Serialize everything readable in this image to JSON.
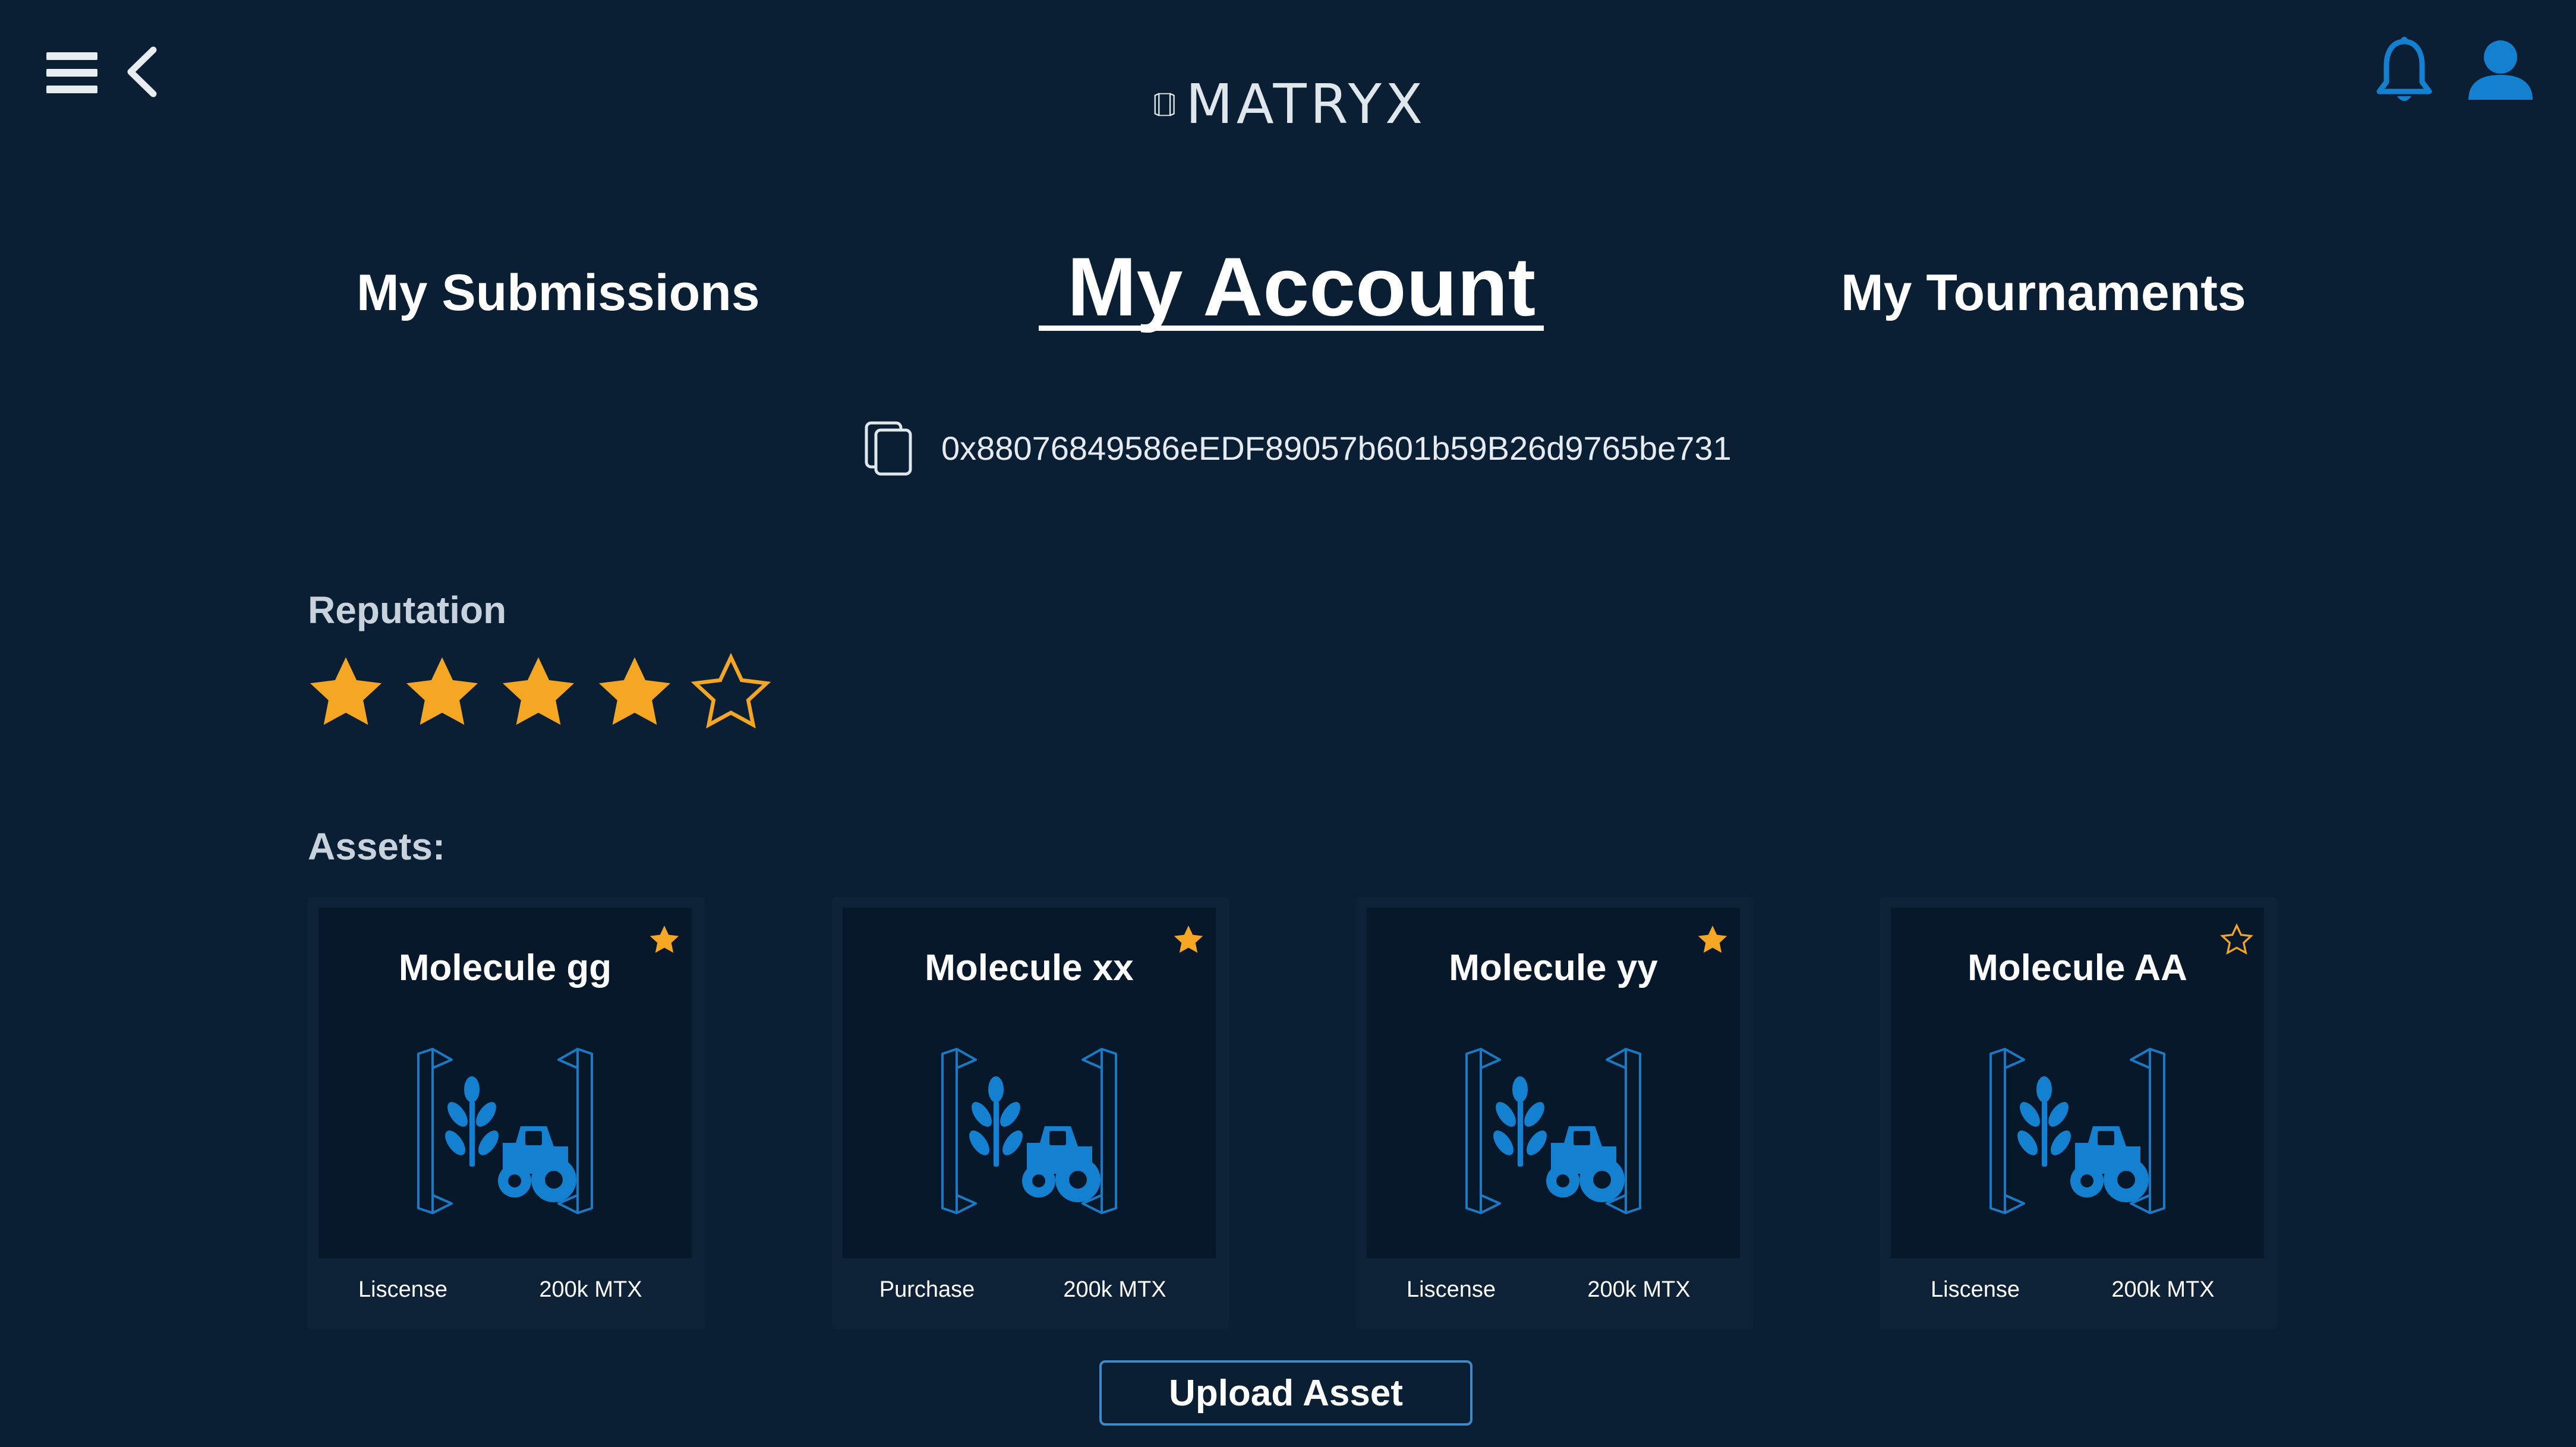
{
  "app": {
    "logo_text": "MATRYX"
  },
  "header": {
    "menu_icon": "hamburger-menu-icon",
    "back_icon": "chevron-left-icon",
    "notification_icon": "bell-icon",
    "profile_icon": "user-icon"
  },
  "tabs": {
    "submissions": "My Submissions",
    "account": "My Account",
    "tournaments": "My Tournaments",
    "active": "account"
  },
  "wallet": {
    "copy_icon": "copy-icon",
    "address": "0x88076849586eEDF89057b601b59B26d9765be731"
  },
  "reputation": {
    "label": "Reputation",
    "rating": 4,
    "max": 5
  },
  "assets": {
    "label": "Assets:",
    "items": [
      {
        "name": "Molecule gg",
        "favorite": true,
        "action": "Liscense",
        "price": "200k MTX"
      },
      {
        "name": "Molecule xx",
        "favorite": true,
        "action": "Purchase",
        "price": "200k MTX"
      },
      {
        "name": "Molecule yy",
        "favorite": true,
        "action": "Liscense",
        "price": "200k MTX"
      },
      {
        "name": "Molecule AA",
        "favorite": false,
        "action": "Liscense",
        "price": "200k MTX"
      }
    ]
  },
  "upload": {
    "label": "Upload Asset"
  },
  "colors": {
    "background": "#0a1f33",
    "accent": "#1380d0",
    "star": "#f5a623",
    "button_border": "#3f8bc9"
  }
}
